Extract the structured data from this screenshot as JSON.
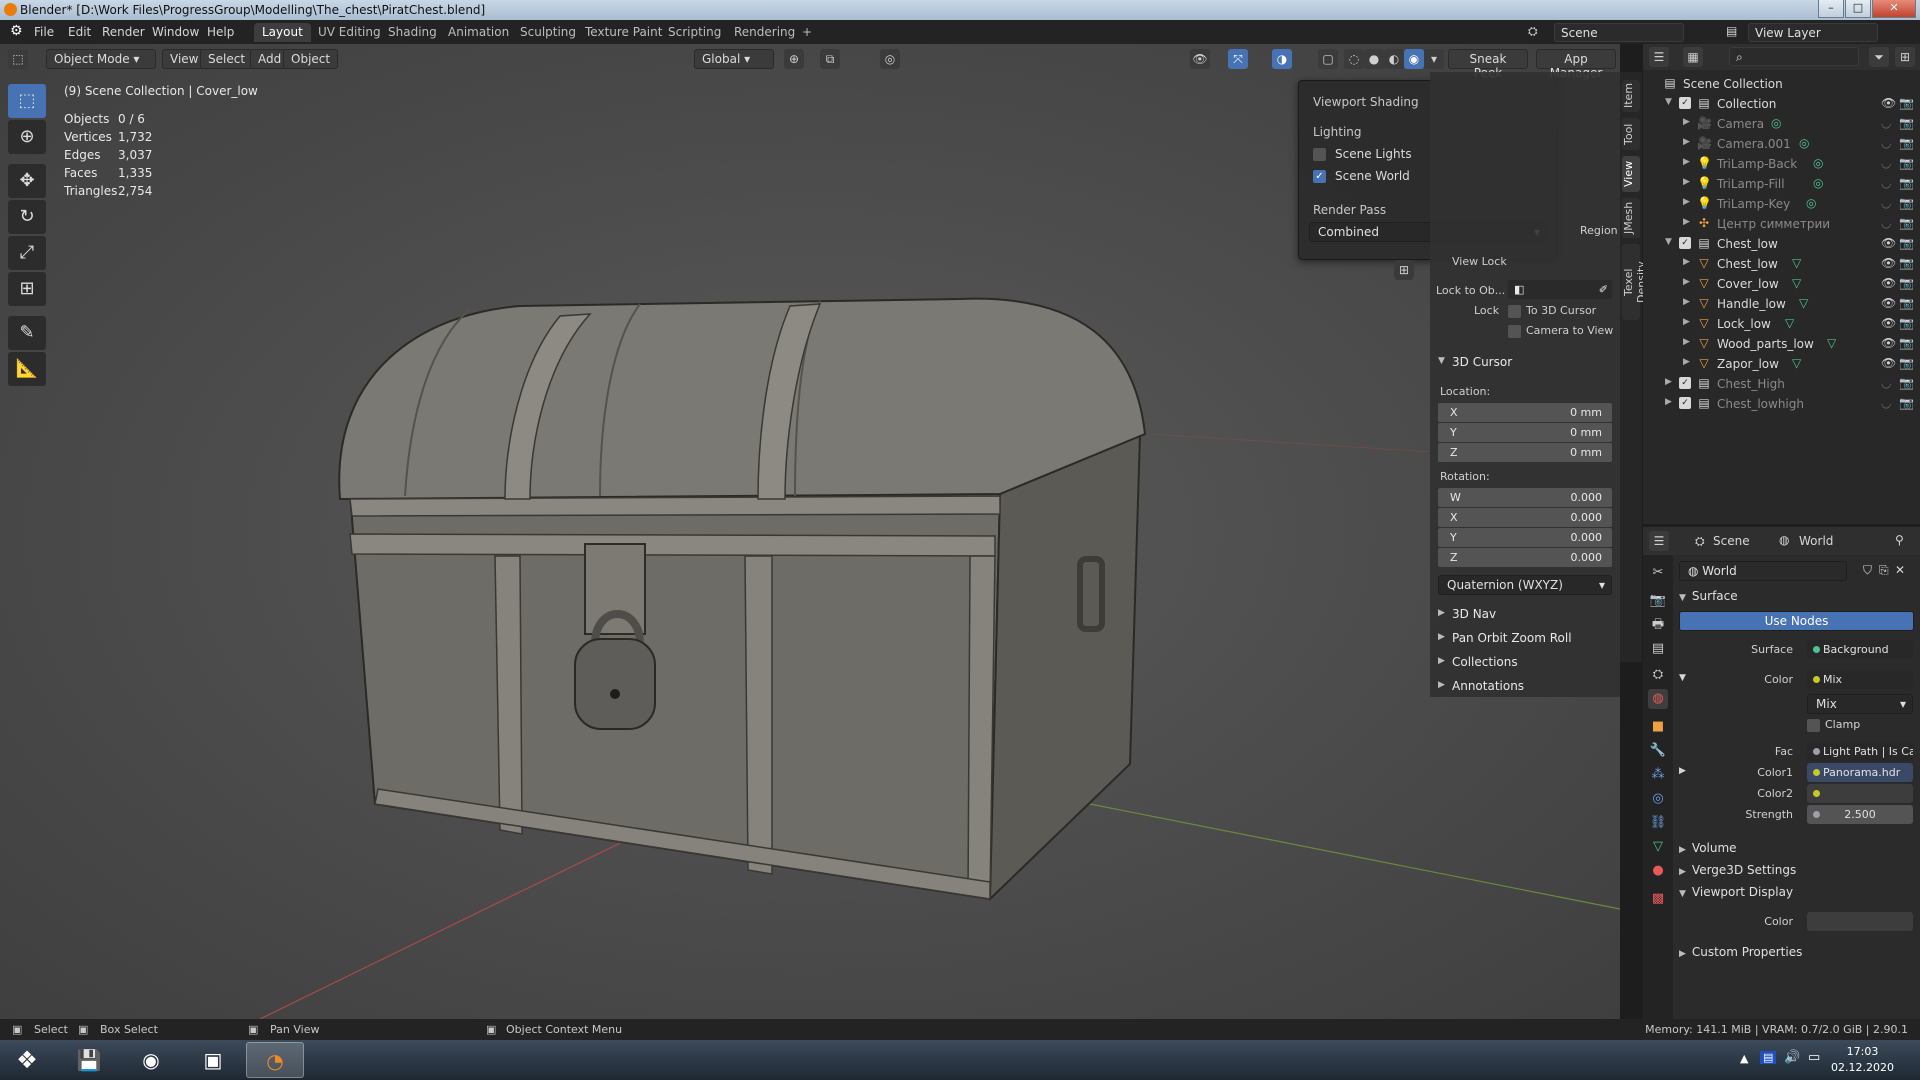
{
  "window": {
    "title": "Blender* [D:\\Work Files\\ProgressGroup\\Modelling\\The_chest\\PiratChest.blend]"
  },
  "menubar": {
    "items": [
      "File",
      "Edit",
      "Render",
      "Window",
      "Help"
    ],
    "workspaces": [
      "Layout",
      "UV Editing",
      "Shading",
      "Animation",
      "Sculpting",
      "Texture Paint",
      "Scripting",
      "Rendering"
    ],
    "active_workspace": "Layout",
    "scene": "Scene",
    "view_layer": "View Layer"
  },
  "viewport_header": {
    "mode": "Object Mode",
    "menus": [
      "View",
      "Select",
      "Add",
      "Object"
    ],
    "transform_orientation": "Global",
    "sneak_peek": "Sneak Peek",
    "app_manager": "App Manager"
  },
  "overlay": {
    "title": "(9) Scene Collection | Cover_low",
    "stats": [
      {
        "label": "Objects",
        "value": "0 / 6"
      },
      {
        "label": "Vertices",
        "value": "1,732"
      },
      {
        "label": "Edges",
        "value": "3,037"
      },
      {
        "label": "Faces",
        "value": "1,335"
      },
      {
        "label": "Triangles",
        "value": "2,754"
      }
    ]
  },
  "shading_popover": {
    "title": "Viewport Shading",
    "lighting": "Lighting",
    "scene_lights": "Scene Lights",
    "scene_world": "Scene World",
    "render_pass": "Render Pass",
    "render_pass_value": "Combined"
  },
  "npanel": {
    "region": "Region",
    "view_lock": "View Lock",
    "lock_to_obj": "Lock to Ob...",
    "lock": "Lock",
    "to_3d_cursor": "To 3D Cursor",
    "camera_to_view": "Camera to View",
    "cursor_header": "3D Cursor",
    "location_label": "Location:",
    "location": [
      {
        "k": "X",
        "v": "0 mm"
      },
      {
        "k": "Y",
        "v": "0 mm"
      },
      {
        "k": "Z",
        "v": "0 mm"
      }
    ],
    "rotation_label": "Rotation:",
    "rotation": [
      {
        "k": "W",
        "v": "0.000"
      },
      {
        "k": "X",
        "v": "0.000"
      },
      {
        "k": "Y",
        "v": "0.000"
      },
      {
        "k": "Z",
        "v": "0.000"
      }
    ],
    "rotation_mode": "Quaternion (WXYZ)",
    "sections": [
      "3D Nav",
      "Pan Orbit Zoom Roll",
      "Collections",
      "Annotations"
    ],
    "tabs": [
      "Item",
      "Tool",
      "View",
      "JMesh",
      "Texel Density"
    ],
    "active_tab": "View"
  },
  "outliner": {
    "root": "Scene Collection",
    "rows": [
      {
        "label": "Collection",
        "type": "collection",
        "depth": 0,
        "dim": false
      },
      {
        "label": "Camera",
        "type": "camera",
        "depth": 1,
        "dim": true
      },
      {
        "label": "Camera.001",
        "type": "camera",
        "depth": 1,
        "dim": true
      },
      {
        "label": "TriLamp-Back",
        "type": "light",
        "depth": 1,
        "dim": true
      },
      {
        "label": "TriLamp-Fill",
        "type": "light",
        "depth": 1,
        "dim": true
      },
      {
        "label": "TriLamp-Key",
        "type": "light",
        "depth": 1,
        "dim": true
      },
      {
        "label": "Центр симметрии",
        "type": "empty",
        "depth": 1,
        "dim": true
      },
      {
        "label": "Chest_low",
        "type": "collection",
        "depth": 0,
        "dim": false
      },
      {
        "label": "Chest_low",
        "type": "mesh",
        "depth": 1,
        "dim": false
      },
      {
        "label": "Cover_low",
        "type": "mesh",
        "depth": 1,
        "dim": false
      },
      {
        "label": "Handle_low",
        "type": "mesh",
        "depth": 1,
        "dim": false
      },
      {
        "label": "Lock_low",
        "type": "mesh",
        "depth": 1,
        "dim": false
      },
      {
        "label": "Wood_parts_low",
        "type": "mesh",
        "depth": 1,
        "dim": false
      },
      {
        "label": "Zapor_low",
        "type": "mesh",
        "depth": 1,
        "dim": false
      },
      {
        "label": "Chest_High",
        "type": "collection",
        "depth": 0,
        "dim": true
      },
      {
        "label": "Chest_lowhigh",
        "type": "collection",
        "depth": 0,
        "dim": true
      }
    ]
  },
  "properties": {
    "scene": "Scene",
    "world": "World",
    "world_name": "World",
    "surface_section": "Surface",
    "use_nodes": "Use Nodes",
    "surface_label": "Surface",
    "surface_value": "Background",
    "color_label": "Color",
    "color_value": "Mix",
    "blend_value": "Mix",
    "clamp": "Clamp",
    "fac_label": "Fac",
    "fac_value": "Light Path | Is Came...",
    "color1_label": "Color1",
    "color1_value": "Panorama.hdr",
    "color2_label": "Color2",
    "strength_label": "Strength",
    "strength_value": "2.500",
    "volume": "Volume",
    "verge3d": "Verge3D Settings",
    "viewport_display": "Viewport Display",
    "vd_color": "Color",
    "custom_props": "Custom Properties"
  },
  "statusbar": {
    "select": "Select",
    "box_select": "Box Select",
    "pan_view": "Pan View",
    "context_menu": "Object Context Menu",
    "memory": "Memory: 141.1 MiB | VRAM: 0.7/2.0 GiB | 2.90.1"
  },
  "taskbar": {
    "time": "17:03",
    "date": "02.12.2020"
  },
  "colors": {
    "accent": "#4772b3",
    "viewport_bg": "#4b4b4b",
    "panel_bg": "#303030"
  }
}
